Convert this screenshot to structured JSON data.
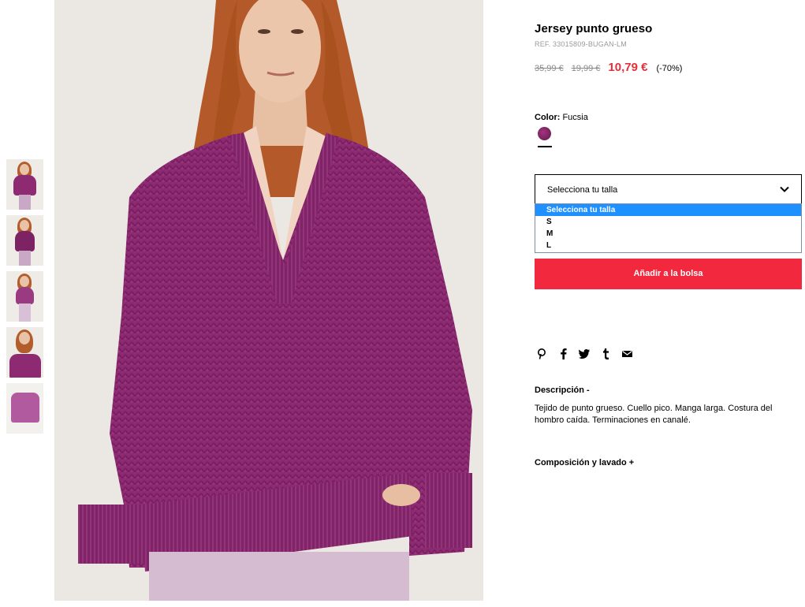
{
  "product": {
    "title": "Jersey punto grueso",
    "ref": "REF. 33015809-BUGAN-LM",
    "prices": {
      "original": "35,99 €",
      "previous": "19,99 €",
      "current": "10,79 €",
      "discount": "(-70%)"
    },
    "color": {
      "label": "Color:",
      "value": "Fucsia"
    }
  },
  "size_select": {
    "label": "Selecciona tu talla",
    "options": [
      "Selecciona tu talla",
      "S",
      "M",
      "L"
    ],
    "selected_index": 0
  },
  "add_to_bag": "Añadir a la bolsa",
  "share_icons": [
    "pinterest-icon",
    "facebook-icon",
    "twitter-icon",
    "tumblr-icon",
    "email-icon"
  ],
  "description": {
    "title": "Descripción -",
    "text": "Tejido de punto grueso. Cuello pico. Manga larga. Costura del hombro caída. Terminaciones en canalé."
  },
  "composition": {
    "title": "Composición y lavado +"
  },
  "colors": {
    "accent_red": "#f2283e",
    "sale_price": "#e62e3b",
    "sweater": "#8e2a72",
    "select_highlight": "#1e90ff"
  }
}
